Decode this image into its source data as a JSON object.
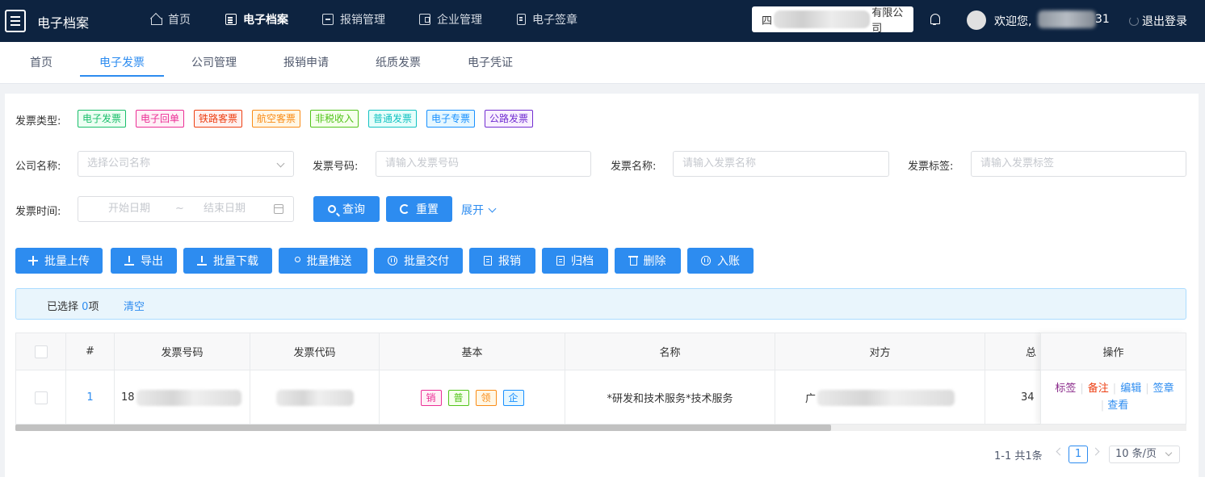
{
  "header": {
    "app_title": "电子档案",
    "nav": [
      {
        "label": "首页",
        "icon": "home-icon"
      },
      {
        "label": "电子档案",
        "icon": "document-icon",
        "active": true
      },
      {
        "label": "报销管理",
        "icon": "reimburse-icon"
      },
      {
        "label": "企业管理",
        "icon": "enterprise-icon"
      },
      {
        "label": "电子签章",
        "icon": "seal-icon"
      }
    ],
    "company_prefix": "四",
    "company_suffix": "有限公司",
    "welcome": "欢迎您,",
    "welcome_tail": "31",
    "logout": "退出登录"
  },
  "tabs": [
    {
      "label": "首页"
    },
    {
      "label": "电子发票",
      "active": true
    },
    {
      "label": "公司管理"
    },
    {
      "label": "报销申请"
    },
    {
      "label": "纸质发票"
    },
    {
      "label": "电子凭证"
    }
  ],
  "filters": {
    "type_label": "发票类型:",
    "types": [
      {
        "label": "电子发票",
        "color": "#19be6b"
      },
      {
        "label": "电子回单",
        "color": "#eb2f96"
      },
      {
        "label": "铁路客票",
        "color": "#ed4014"
      },
      {
        "label": "航空客票",
        "color": "#fa8c16"
      },
      {
        "label": "非税收入",
        "color": "#52c41a"
      },
      {
        "label": "普通发票",
        "color": "#13c2c2"
      },
      {
        "label": "电子专票",
        "color": "#1890ff"
      },
      {
        "label": "公路发票",
        "color": "#722ed1"
      }
    ],
    "company_label": "公司名称:",
    "company_placeholder": "选择公司名称",
    "invoice_no_label": "发票号码:",
    "invoice_no_placeholder": "请输入发票号码",
    "invoice_name_label": "发票名称:",
    "invoice_name_placeholder": "请输入发票名称",
    "invoice_tag_label": "发票标签:",
    "invoice_tag_placeholder": "请输入发票标签",
    "time_label": "发票时间:",
    "start_placeholder": "开始日期",
    "range_sep": "~",
    "end_placeholder": "结束日期",
    "search_btn": "查询",
    "reset_btn": "重置",
    "expand": "展开"
  },
  "actions": [
    {
      "label": "批量上传",
      "icon": "plus-icon"
    },
    {
      "label": "导出",
      "icon": "export-icon"
    },
    {
      "label": "批量下载",
      "icon": "download-icon"
    },
    {
      "label": "批量推送",
      "icon": "push-icon"
    },
    {
      "label": "批量交付",
      "icon": "deliver-icon"
    },
    {
      "label": "报销",
      "icon": "reimburse-icon"
    },
    {
      "label": "归档",
      "icon": "archive-icon"
    },
    {
      "label": "删除",
      "icon": "trash-icon"
    },
    {
      "label": "入账",
      "icon": "post-icon"
    }
  ],
  "selection": {
    "prefix": "已选择",
    "count": "0",
    "suffix": "项",
    "clear": "清空"
  },
  "table": {
    "columns": [
      "#",
      "发票号码",
      "发票代码",
      "基本",
      "名称",
      "对方",
      "总",
      "操作"
    ],
    "rows": [
      {
        "index": "1",
        "invoice_no_prefix": "18",
        "basic_tags": [
          {
            "label": "销",
            "color": "#eb2f96"
          },
          {
            "label": "普",
            "color": "#52c41a"
          },
          {
            "label": "领",
            "color": "#fa8c16"
          },
          {
            "label": "企",
            "color": "#1890ff"
          }
        ],
        "name": "*研发和技术服务*技术服务",
        "counterparty_prefix": "广",
        "total_prefix": "34"
      }
    ],
    "ops": {
      "tag": "标签",
      "note": "备注",
      "edit": "编辑",
      "seal": "签章",
      "view": "查看"
    }
  },
  "pagination": {
    "total": "1-1 共1条",
    "current": "1",
    "page_size": "10 条/页"
  }
}
